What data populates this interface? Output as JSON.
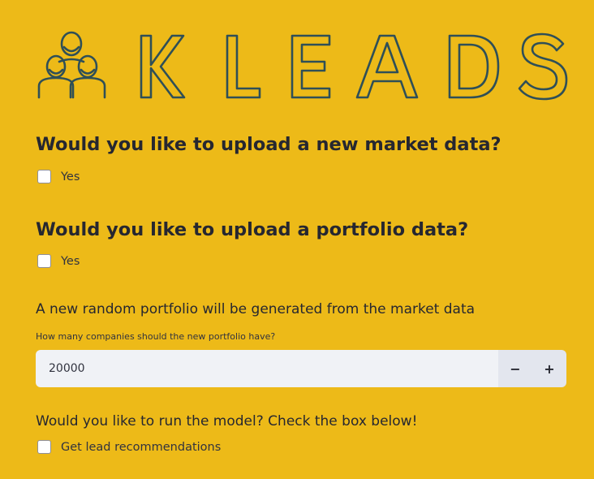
{
  "brand": {
    "logo_text": "KLEADS",
    "color": "#2f4f57"
  },
  "sections": {
    "market": {
      "question": "Would you like to upload a new market data?",
      "checkbox_label": "Yes",
      "checked": false
    },
    "portfolio": {
      "question": "Would you like to upload a portfolio data?",
      "checkbox_label": "Yes",
      "checked": false
    },
    "random_portfolio": {
      "heading": "A new random portfolio will be generated from the market data",
      "input_label": "How many companies should the new portfolio have?",
      "value": "20000",
      "decrement": "−",
      "increment": "+"
    },
    "run_model": {
      "heading": "Would you like to run the model? Check the box below!",
      "checkbox_label": "Get lead recommendations",
      "checked": false
    }
  },
  "colors": {
    "background": "#edba18",
    "text": "#262730",
    "input_bg": "#f0f2f6"
  }
}
